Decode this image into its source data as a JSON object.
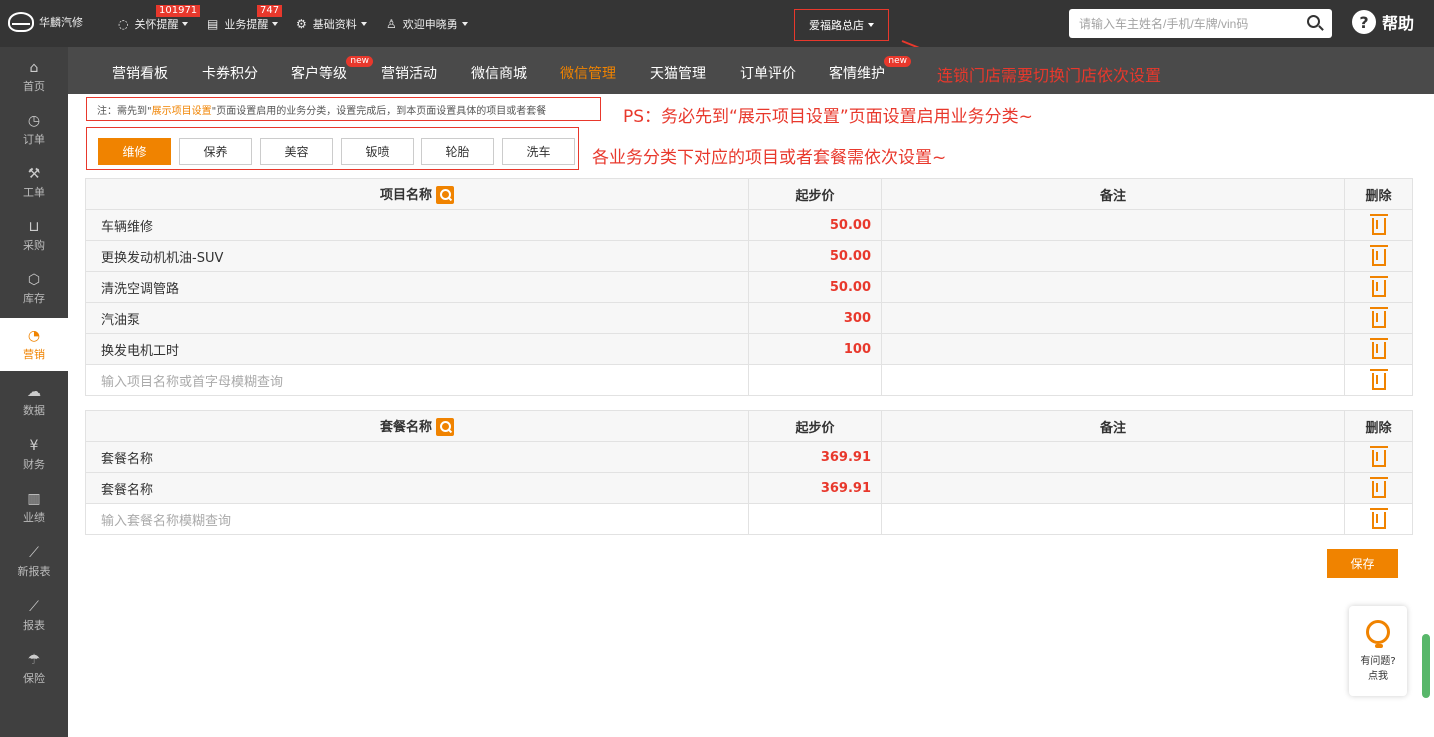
{
  "brand": {
    "name": "华麟汽修"
  },
  "topnav": {
    "care": {
      "label": "关怀提醒",
      "badge": "101971"
    },
    "business": {
      "label": "业务提醒",
      "badge": "747"
    },
    "basic": {
      "label": "基础资料"
    },
    "user": {
      "label": "欢迎申晓勇"
    },
    "store": "爱福路总店",
    "search_placeholder": "请输入车主姓名/手机/车牌/vin码",
    "help": "帮助"
  },
  "subnav": {
    "items": [
      "营销看板",
      "卡券积分",
      "客户等级",
      "营销活动",
      "微信商城",
      "微信管理",
      "天猫管理",
      "订单评价",
      "客情维护"
    ],
    "new_label": "new",
    "note": "连锁门店需要切换门店依次设置"
  },
  "sidebar": {
    "items": [
      "首页",
      "订单",
      "工单",
      "采购",
      "库存",
      "营销",
      "数据",
      "财务",
      "业绩",
      "新报表",
      "报表",
      "保险"
    ]
  },
  "notice": {
    "prefix": "注：需先到\"",
    "link": "展示项目设置",
    "suffix": "\"页面设置启用的业务分类，设置完成后，到本页面设置具体的项目或者套餐"
  },
  "ps_note": "PS：务必先到“展示项目设置”页面设置启用业务分类~",
  "categories": [
    "维修",
    "保养",
    "美容",
    "钣喷",
    "轮胎",
    "洗车"
  ],
  "category_note": "各业务分类下对应的项目或者套餐需依次设置~",
  "items_table": {
    "headers": {
      "name": "项目名称",
      "price": "起步价",
      "remark": "备注",
      "delete": "删除"
    },
    "rows": [
      {
        "name": "车辆维修",
        "price": "50.00"
      },
      {
        "name": "更换发动机机油-SUV",
        "price": "50.00"
      },
      {
        "name": "清洗空调管路",
        "price": "50.00"
      },
      {
        "name": "汽油泵",
        "price": "300"
      },
      {
        "name": "换发电机工时",
        "price": "100"
      }
    ],
    "input_placeholder": "输入项目名称或首字母模糊查询"
  },
  "package_table": {
    "headers": {
      "name": "套餐名称",
      "price": "起步价",
      "remark": "备注",
      "delete": "删除"
    },
    "rows": [
      {
        "name": "套餐名称",
        "price": "369.91"
      },
      {
        "name": "套餐名称",
        "price": "369.91"
      }
    ],
    "input_placeholder": "输入套餐名称模糊查询"
  },
  "save_label": "保存",
  "chat": {
    "line1": "有问题?",
    "line2": "点我"
  },
  "colors": {
    "accent": "#f08300",
    "alert": "#e8382c",
    "topbar": "#353535",
    "sidebar": "#404040"
  }
}
